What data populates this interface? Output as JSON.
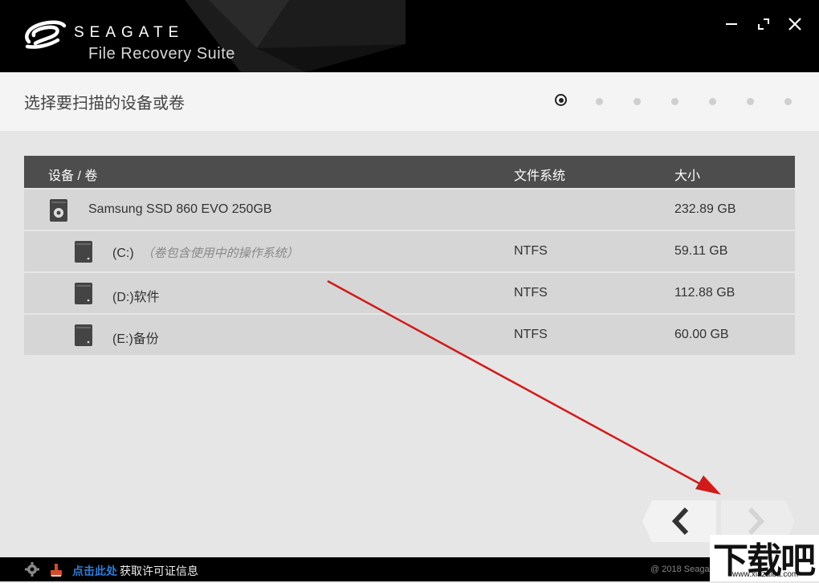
{
  "app": {
    "brand": "SEAGATE",
    "product": "File Recovery Suite"
  },
  "window_controls": [
    "minimize-icon",
    "maximize-icon",
    "close-icon"
  ],
  "step": {
    "title": "选择要扫描的设备或卷",
    "total": 7,
    "current": 1
  },
  "table": {
    "headers": {
      "device": "设备 / 卷",
      "filesystem": "文件系统",
      "size": "大小"
    },
    "rows": [
      {
        "name": "Samsung SSD 860 EVO 250GB",
        "note": "",
        "filesystem": "",
        "size": "232.89 GB",
        "level": 0,
        "icon": "disk-icon"
      },
      {
        "name": "(C:)",
        "note": "（卷包含使用中的操作系统）",
        "filesystem": "NTFS",
        "size": "59.11 GB",
        "level": 1,
        "icon": "volume-icon"
      },
      {
        "name": "(D:)软件",
        "note": "",
        "filesystem": "NTFS",
        "size": "112.88 GB",
        "level": 1,
        "icon": "volume-icon"
      },
      {
        "name": "(E:)备份",
        "note": "",
        "filesystem": "NTFS",
        "size": "60.00 GB",
        "level": 1,
        "icon": "volume-icon"
      }
    ]
  },
  "nav": {
    "back_icon": "chevron-left-icon",
    "next_icon": "chevron-right-icon"
  },
  "footer": {
    "link": "点击此处",
    "info": "获取许可证信息",
    "copyright": "@ 2018 Seaga"
  },
  "watermark": {
    "big": "下载吧",
    "small": "www.xiazaiba.com"
  },
  "colors": {
    "header_bg": "#000000",
    "table_header_bg": "#4d4d4d",
    "row_bg": "#d6d6d6",
    "link": "#2b7cd8",
    "annotation_arrow": "#d11a1a"
  }
}
